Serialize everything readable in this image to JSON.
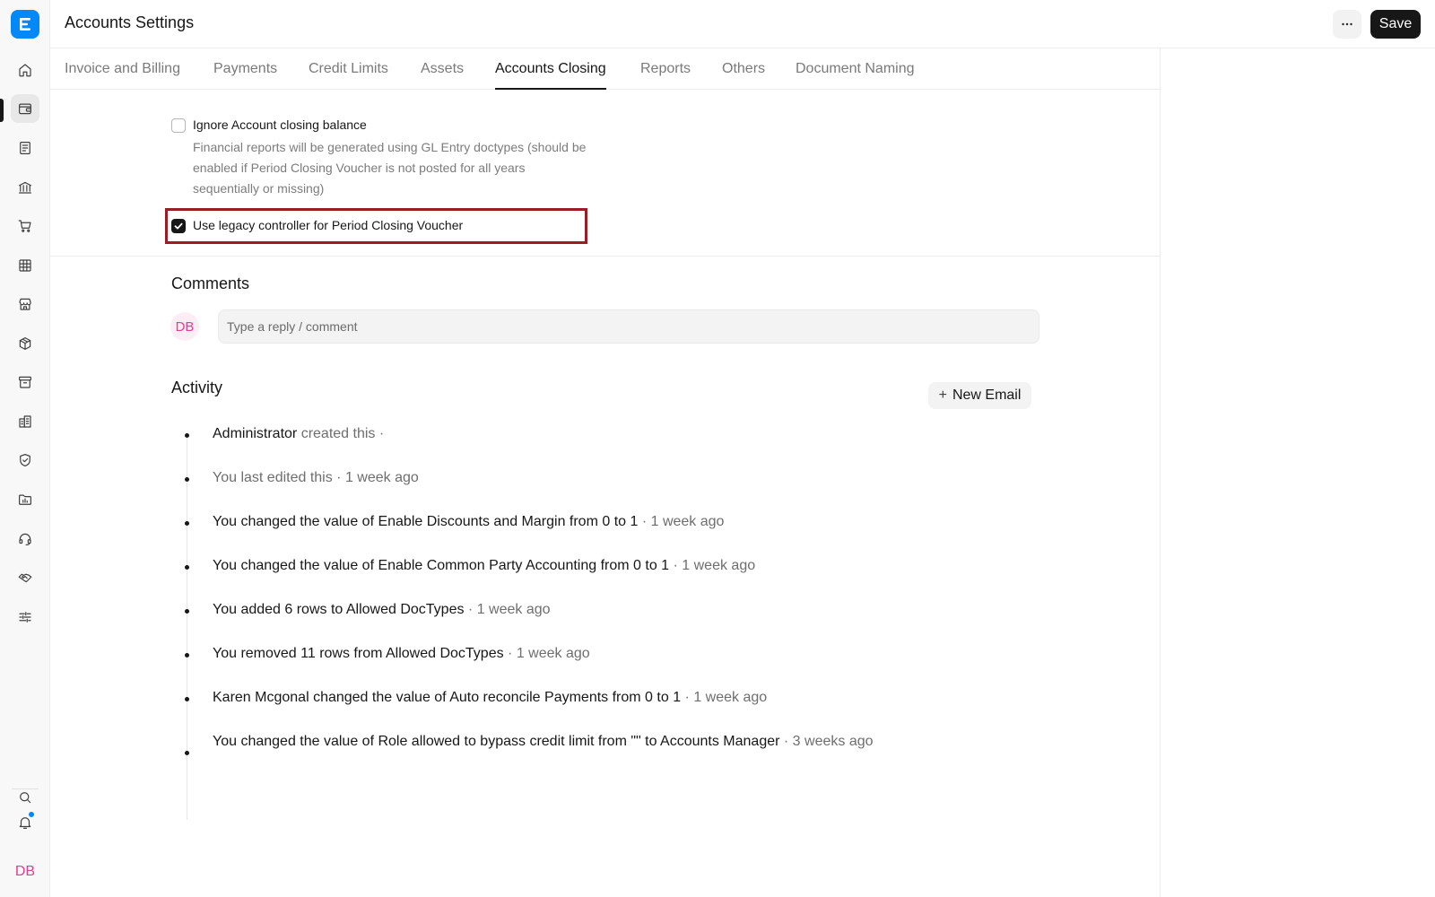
{
  "app": {
    "logo_letter": "E",
    "user_initials": "DB"
  },
  "header": {
    "title": "Accounts Settings",
    "save_label": "Save"
  },
  "sidebar": {
    "items": [
      {
        "icon": "home-icon"
      },
      {
        "icon": "wallet-icon",
        "active": true
      },
      {
        "icon": "document-icon"
      },
      {
        "icon": "bank-icon"
      },
      {
        "icon": "cart-icon"
      },
      {
        "icon": "table-icon"
      },
      {
        "icon": "store-icon"
      },
      {
        "icon": "box-icon"
      },
      {
        "icon": "archive-icon"
      },
      {
        "icon": "building-icon"
      },
      {
        "icon": "shield-icon"
      },
      {
        "icon": "folder-chart-icon"
      },
      {
        "icon": "headset-icon"
      },
      {
        "icon": "handshake-icon"
      },
      {
        "icon": "sliders-icon"
      }
    ],
    "bottom": [
      {
        "icon": "search-icon"
      },
      {
        "icon": "bell-icon",
        "has_notification": true
      }
    ]
  },
  "tabs": [
    {
      "label": "Invoice and Billing"
    },
    {
      "label": "Payments"
    },
    {
      "label": "Credit Limits"
    },
    {
      "label": "Assets"
    },
    {
      "label": "Accounts Closing",
      "active": true
    },
    {
      "label": "Reports"
    },
    {
      "label": "Others"
    },
    {
      "label": "Document Naming"
    }
  ],
  "settings": {
    "ignore_closing_balance": {
      "label": "Ignore Account closing balance",
      "checked": false,
      "description": "Financial reports will be generated using GL Entry doctypes (should be enabled if Period Closing Voucher is not posted for all years sequentially or missing)"
    },
    "legacy_controller": {
      "label": "Use legacy controller for Period Closing Voucher",
      "checked": true
    }
  },
  "comments": {
    "title": "Comments",
    "avatar_initials": "DB",
    "placeholder": "Type a reply / comment"
  },
  "activity": {
    "title": "Activity",
    "new_email_label": "New Email",
    "items": [
      {
        "actor": "Administrator",
        "text": " created this ·",
        "time": ""
      },
      {
        "actor": "",
        "text": "You last edited this · 1 week ago",
        "time": ""
      },
      {
        "actor": "",
        "text": "You changed the value of Enable Discounts and Margin from 0 to 1",
        "time": " · 1 week ago"
      },
      {
        "actor": "",
        "text": "You changed the value of Enable Common Party Accounting from 0 to 1",
        "time": " · 1 week ago"
      },
      {
        "actor": "",
        "text": "You added 6 rows to Allowed DocTypes",
        "time": " · 1 week ago"
      },
      {
        "actor": "",
        "text": "You removed 11 rows from Allowed DocTypes",
        "time": " · 1 week ago"
      },
      {
        "actor": "",
        "text": "Karen Mcgonal changed the value of Auto reconcile Payments from 0 to 1",
        "time": " · 1 week ago"
      },
      {
        "actor": "",
        "text": "You changed the value of Role allowed to bypass credit limit from \"\" to Accounts Manager",
        "time": " · 3 weeks ago"
      }
    ]
  },
  "colors": {
    "accent": "#0289f7",
    "highlight_border": "#9b1c22",
    "avatar": "#e13f8f"
  }
}
